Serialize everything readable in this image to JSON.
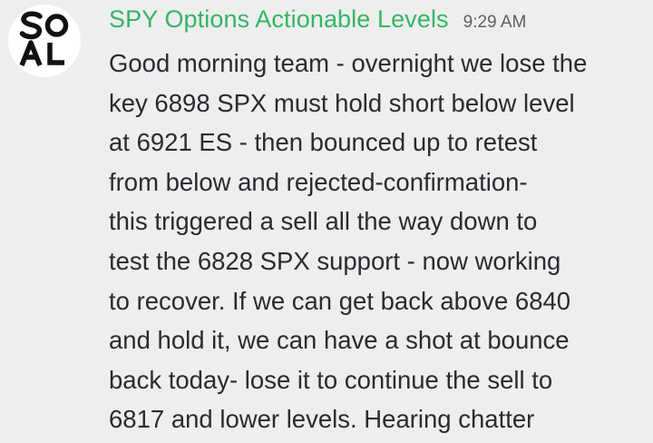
{
  "message": {
    "avatar": {
      "logo_text": "SOAL",
      "icon": "soal-logo-icon"
    },
    "username": "SPY Options Actionable Levels",
    "timestamp": "9:29 AM",
    "content_lines": [
      "Good morning team - overnight we lose the",
      "key 6898 SPX must hold short below level",
      "at 6921 ES - then bounced up to retest",
      "from below and rejected-confirmation-",
      "this triggered a sell all the way down to",
      "test the 6828 SPX support - now working",
      "to recover. If we can get back above 6840",
      "and hold it, we can have a shot at bounce",
      "back today- lose it to continue the sell to",
      "6817 and lower levels. Hearing chatter"
    ]
  },
  "colors": {
    "background": "#eeeeef",
    "username": "#34b564",
    "timestamp": "#5f6068",
    "text": "#2a2b30"
  }
}
